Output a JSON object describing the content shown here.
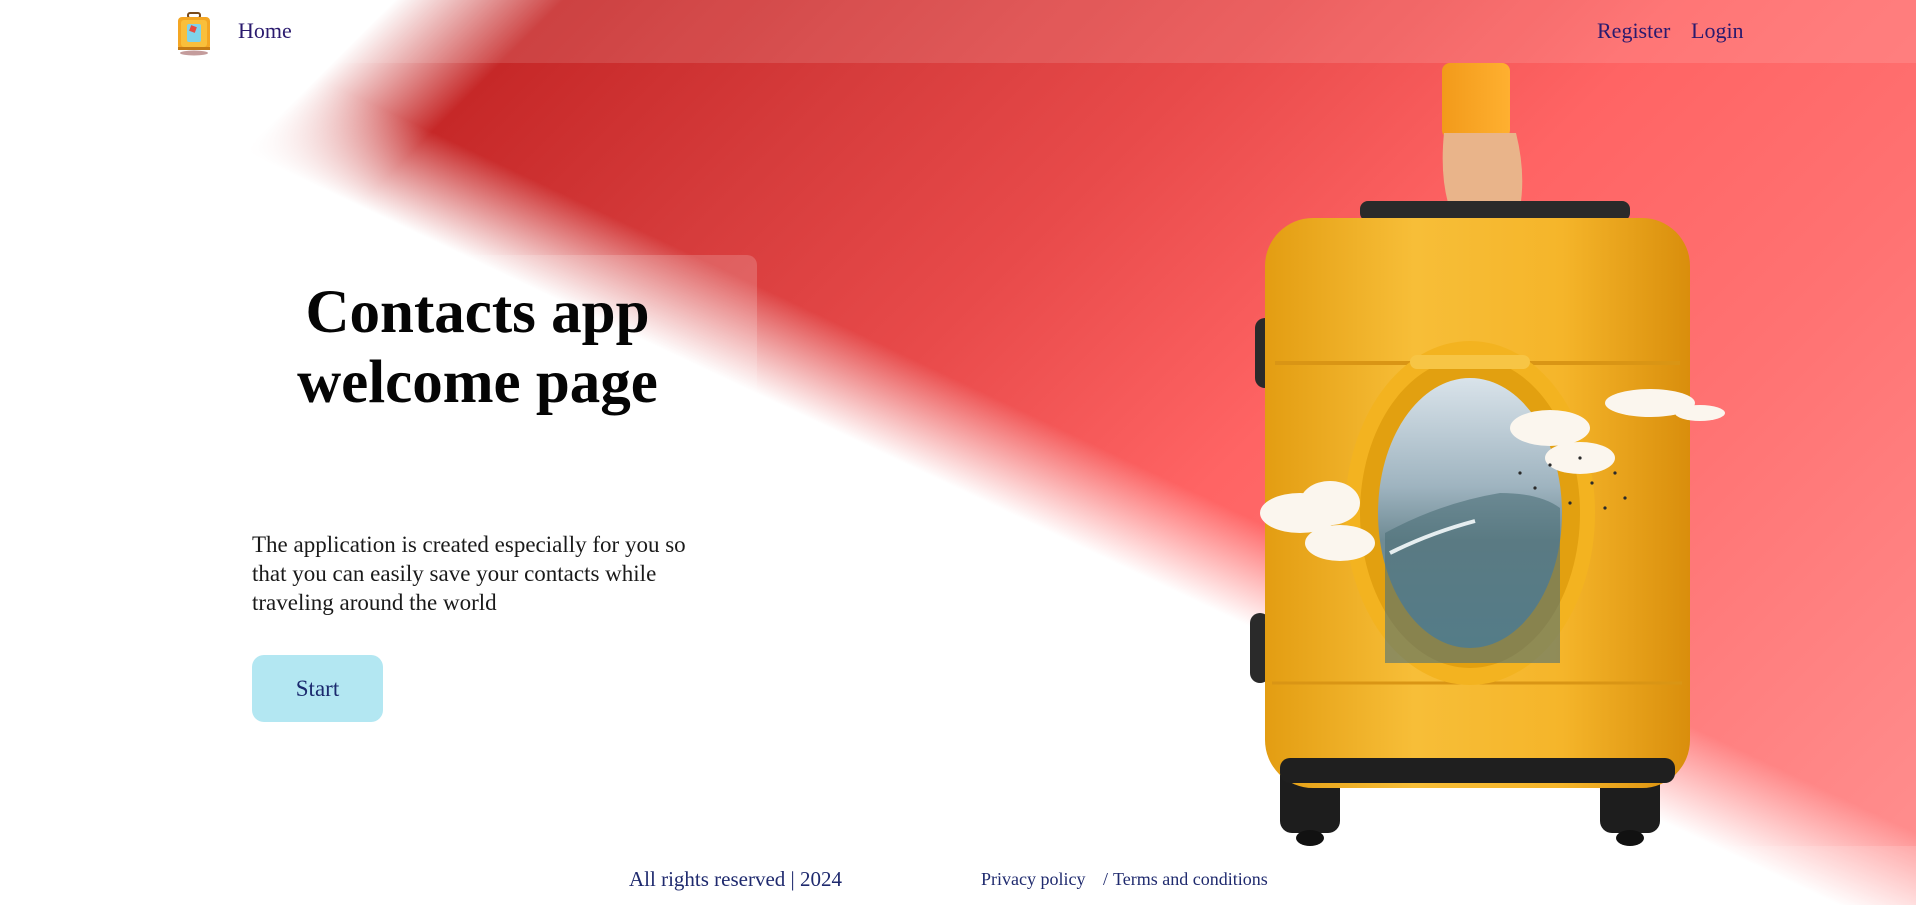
{
  "nav": {
    "logo_icon": "suitcase-logo-icon",
    "home_label": "Home",
    "register_label": "Register",
    "login_label": "Login"
  },
  "hero": {
    "title_line1": "Contacts app",
    "title_line2": "welcome page",
    "description": "The application is created especially for you so that you can easily save your contacts while traveling around the world",
    "start_label": "Start",
    "illustration_icon": "suitcase-airplane-window-illustration"
  },
  "footer": {
    "copyright": "All rights reserved | 2024",
    "privacy_label": "Privacy policy",
    "separator": "/",
    "terms_label": "Terms and conditions"
  },
  "colors": {
    "accent_red": "#e84a4a",
    "button_bg": "#b3e7f2",
    "link_color": "#2a1a6e",
    "suitcase_yellow": "#f5b52a"
  }
}
